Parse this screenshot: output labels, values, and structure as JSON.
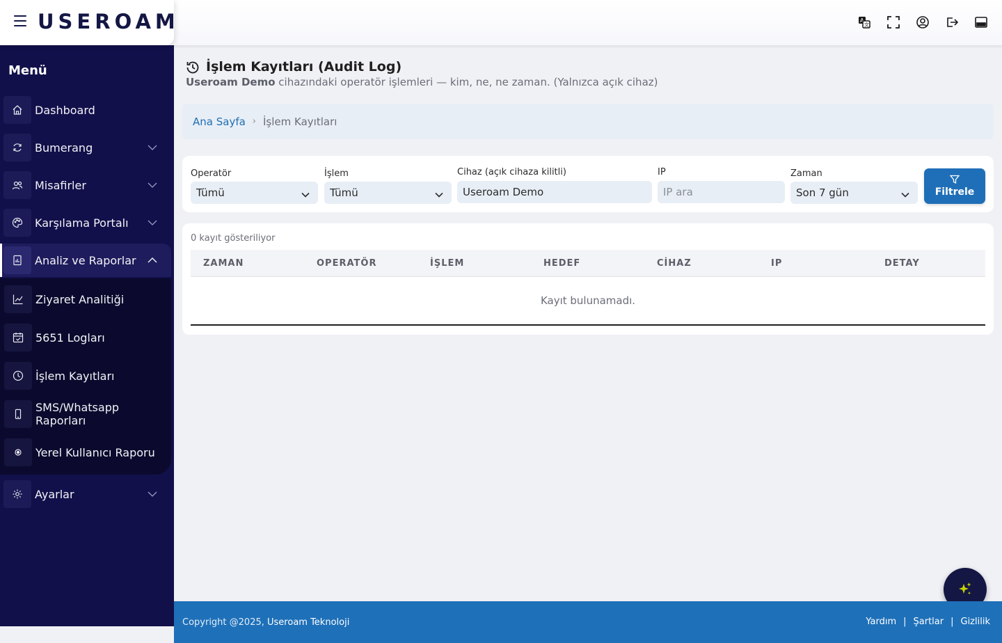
{
  "header": {
    "logo_text": "USEROAM",
    "icons": [
      "translate-icon",
      "fullscreen-icon",
      "user-circle-icon",
      "logout-icon",
      "device-icon"
    ]
  },
  "sidebar": {
    "title": "Menü",
    "items": [
      {
        "label": "Dashboard",
        "icon": "home-icon"
      },
      {
        "label": "Bumerang",
        "icon": "refresh-icon"
      },
      {
        "label": "Misafirler",
        "icon": "users-icon"
      },
      {
        "label": "Karşılama Portalı",
        "icon": "palette-icon"
      },
      {
        "label": "Analiz ve Raporlar",
        "icon": "report-icon"
      },
      {
        "label": "Ayarlar",
        "icon": "gear-icon"
      }
    ],
    "submenu": [
      {
        "label": "Ziyaret Analitiği",
        "icon": "chart-line-icon"
      },
      {
        "label": "5651 Logları",
        "icon": "calendar-check-icon"
      },
      {
        "label": "İşlem Kayıtları",
        "icon": "clock-icon"
      },
      {
        "label": "SMS/Whatsapp Raporları",
        "icon": "phone-icon"
      },
      {
        "label": "Yerel Kullanıcı Raporu",
        "icon": "dot-circle-icon"
      }
    ]
  },
  "page": {
    "title": "İşlem Kayıtları (Audit Log)",
    "subtitle_device": "Useroam Demo",
    "subtitle_rest": " cihazındaki operatör işlemleri — kim, ne, ne zaman. (Yalnızca açık cihaz)"
  },
  "breadcrumb": {
    "home": "Ana Sayfa",
    "current": "İşlem Kayıtları"
  },
  "filters": {
    "operator_label": "Operatör",
    "operator_value": "Tümü",
    "action_label": "İşlem",
    "action_value": "Tümü",
    "device_label": "Cihaz (açık cihaza kilitli)",
    "device_value": "Useroam Demo",
    "ip_label": "IP",
    "ip_placeholder": "IP ara",
    "time_label": "Zaman",
    "time_value": "Son 7 gün",
    "button_label": "Filtrele"
  },
  "table": {
    "count_text": "0 kayıt gösteriliyor",
    "columns": [
      "ZAMAN",
      "OPERATÖR",
      "İŞLEM",
      "HEDEF",
      "CİHAZ",
      "IP",
      "DETAY"
    ],
    "empty_text": "Kayıt bulunamadı."
  },
  "footer": {
    "copyright": "Copyright @2025, ",
    "company": "Useroam Teknoloji",
    "links": [
      "Yardım",
      "Şartlar",
      "Gizlilik"
    ]
  },
  "colors": {
    "sidebar_bg": "#12104a",
    "accent_blue": "#1f6fb8",
    "footer_bg": "#1e70b9",
    "logo_accent": "#c8d400"
  }
}
